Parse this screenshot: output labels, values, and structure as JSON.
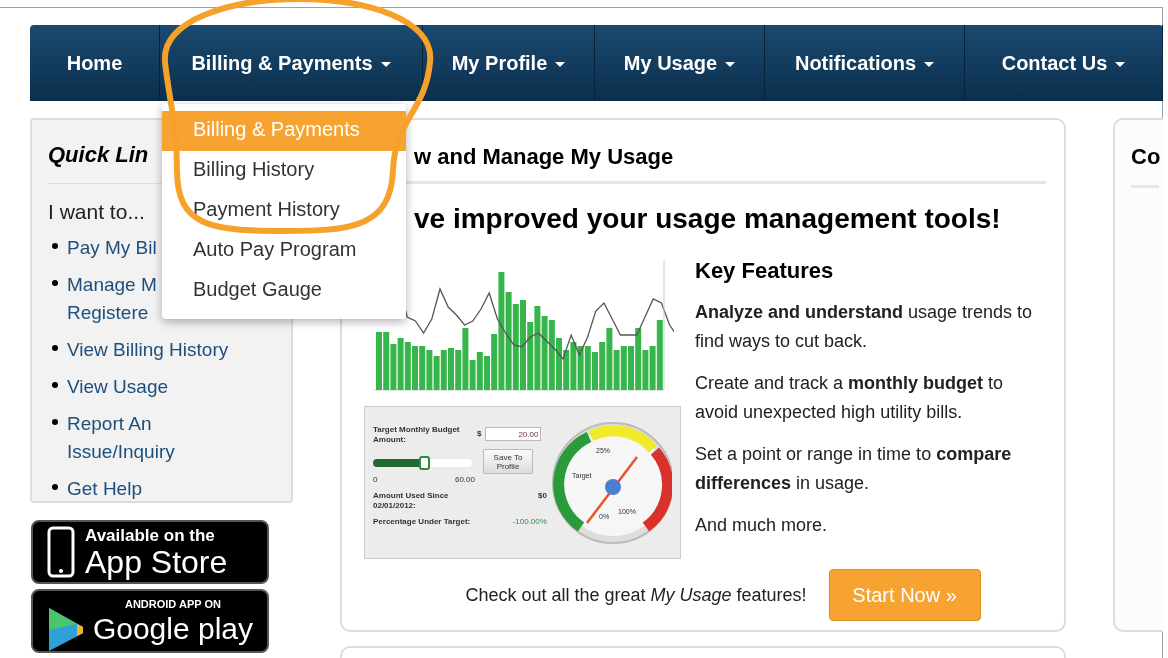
{
  "nav": [
    {
      "label": "Home",
      "has_menu": false
    },
    {
      "label": "Billing & Payments",
      "has_menu": true
    },
    {
      "label": "My Profile",
      "has_menu": true
    },
    {
      "label": "My Usage",
      "has_menu": true
    },
    {
      "label": "Notifications",
      "has_menu": true
    },
    {
      "label": "Contact Us",
      "has_menu": true
    }
  ],
  "dropdown": {
    "items": [
      {
        "label": "Billing & Payments",
        "selected": true
      },
      {
        "label": "Billing History",
        "selected": false
      },
      {
        "label": "Payment History",
        "selected": false
      },
      {
        "label": "Auto Pay Program",
        "selected": false
      },
      {
        "label": "Budget Gauge",
        "selected": false
      }
    ]
  },
  "quick_links": {
    "title": "Quick Lin",
    "intro": "I want to...",
    "links": [
      "Pay My Bil",
      "Manage M\nRegistere",
      "View Billing History",
      "View Usage",
      "Report An\nIssue/Inquiry",
      "Get Help"
    ]
  },
  "app_badges": [
    {
      "kind": "app_store",
      "small": "Available on the",
      "big": "App Store"
    },
    {
      "kind": "google_play",
      "small": "ANDROID APP ON",
      "big": "Google play"
    }
  ],
  "main": {
    "title": "w and Manage My Usage",
    "headline": "ve improved your usage management tools!",
    "budget_widget": {
      "label": "Target Monthly Budget Amount:",
      "currency": "$",
      "value": "20.00",
      "level": 0.52,
      "min": "0",
      "max": "60.00",
      "button": "Save To Profile",
      "used_label": "Amount Used Since 02/01/2012:",
      "used_value": "$0",
      "pct_label": "Percentage Under Target:",
      "pct_value": "-100.00%",
      "gauge_labels": [
        "25%",
        "Target",
        "0%",
        "100%"
      ]
    },
    "features": {
      "title": "Key Features",
      "paragraphs": [
        "**Analyze and understand** usage trends to find ways to cut back.",
        "Create and track a **monthly budget** to avoid unexpected high utility bills.",
        "Set a point or range in time to **compare differences** in usage.",
        "And much more."
      ]
    },
    "cta": {
      "text": "Check out all the great *My Usage* features!",
      "button": "Start Now »"
    }
  },
  "right_panel": {
    "title": "Co"
  }
}
